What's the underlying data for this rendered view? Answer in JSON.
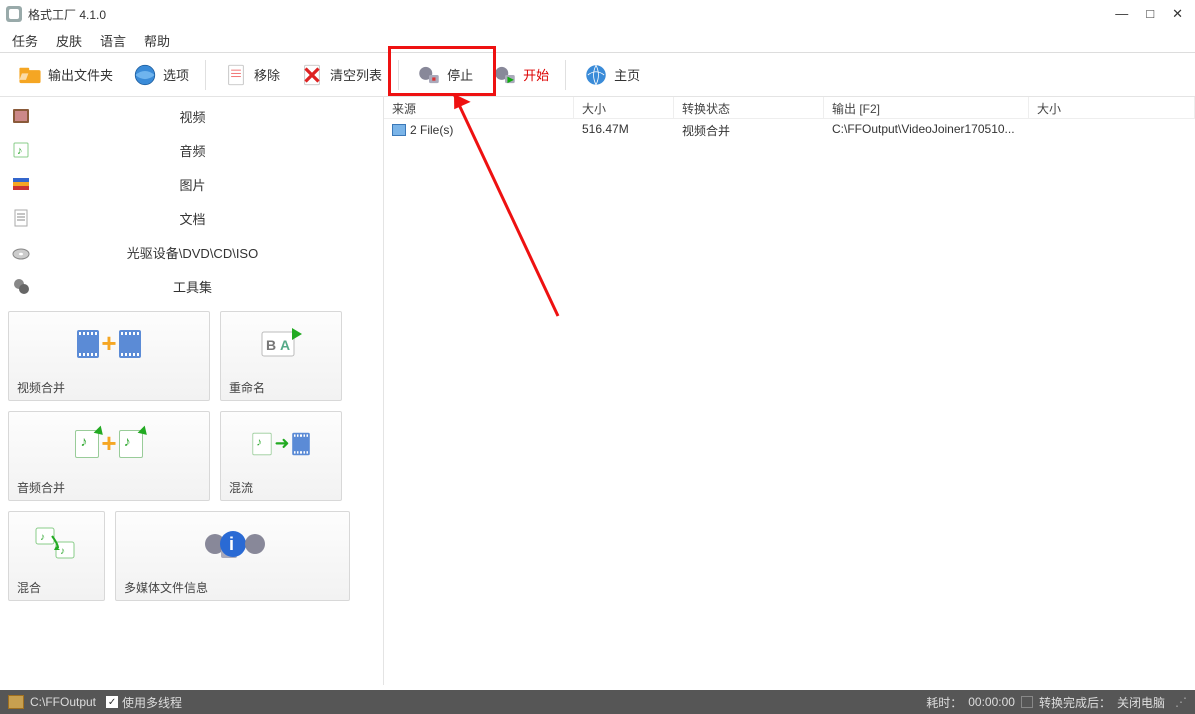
{
  "title": "格式工厂 4.1.0",
  "menu": {
    "task": "任务",
    "skin": "皮肤",
    "lang": "语言",
    "help": "帮助"
  },
  "toolbar": {
    "output": "输出文件夹",
    "options": "选项",
    "remove": "移除",
    "clear": "清空列表",
    "stop": "停止",
    "start": "开始",
    "home": "主页"
  },
  "cats": {
    "video": "视频",
    "audio": "音频",
    "image": "图片",
    "doc": "文档",
    "disc": "光驱设备\\DVD\\CD\\ISO",
    "tools": "工具集"
  },
  "tiles": {
    "vjoin": "视频合并",
    "rename": "重命名",
    "ajoin": "音频合并",
    "mux": "混流",
    "mix": "混合",
    "mediainfo": "多媒体文件信息"
  },
  "columns": {
    "src": "来源",
    "size": "大小",
    "state": "转换状态",
    "out": "输出 [F2]",
    "size2": "大小"
  },
  "row": {
    "src": "2 File(s)",
    "size": "516.47M",
    "state": "视频合并",
    "out": "C:\\FFOutput\\VideoJoiner170510..."
  },
  "status": {
    "path": "C:\\FFOutput",
    "mt": "使用多线程",
    "elapsed_lbl": "耗时：",
    "elapsed": "00:00:00",
    "after_lbl": "转换完成后：",
    "after": "关闭电脑"
  }
}
